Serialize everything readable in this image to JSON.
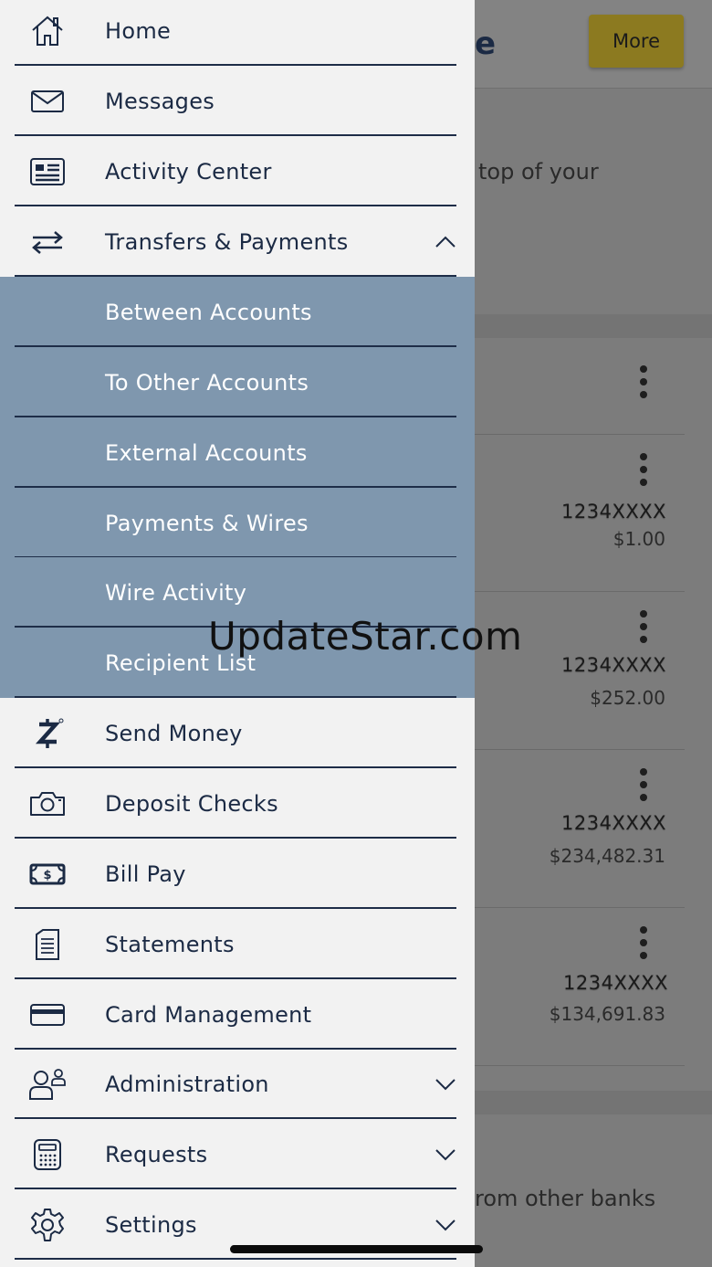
{
  "background": {
    "title_fragment": "e",
    "more_button": "More",
    "intro_fragment": "top of your",
    "footer_fragment": "rom other banks",
    "accounts": [
      {
        "number": "1234XXXX",
        "balance": "$1.00"
      },
      {
        "number": "1234XXXX",
        "balance": "$252.00"
      },
      {
        "number": "1234XXXX",
        "balance": "$234,482.31"
      },
      {
        "number": "1234XXXX",
        "balance": "$134,691.83"
      }
    ]
  },
  "menu": {
    "home": "Home",
    "messages": "Messages",
    "activity_center": "Activity Center",
    "transfers": "Transfers & Payments",
    "sub": {
      "between_accounts": "Between Accounts",
      "to_other_accounts": "To Other Accounts",
      "external_accounts": "External Accounts",
      "payments_wires": "Payments & Wires",
      "wire_activity": "Wire Activity",
      "recipient_list": "Recipient List"
    },
    "send_money": "Send Money",
    "deposit_checks": "Deposit Checks",
    "bill_pay": "Bill Pay",
    "statements": "Statements",
    "card_management": "Card Management",
    "administration": "Administration",
    "requests": "Requests",
    "settings": "Settings"
  },
  "watermark": "UpdateStar.com",
  "colors": {
    "navy": "#1b2a44",
    "submenu_bg": "#7f97ae",
    "drawer_bg": "#f2f2f2",
    "more_button": "#8c7a20"
  }
}
